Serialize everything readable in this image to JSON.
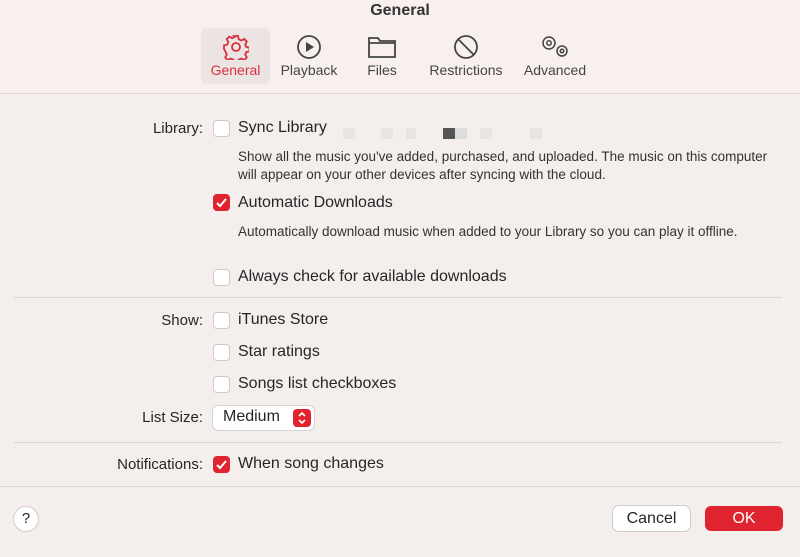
{
  "window": {
    "title": "General"
  },
  "tabs": [
    {
      "label": "General",
      "icon": "gear-icon",
      "active": true
    },
    {
      "label": "Playback",
      "icon": "play-circle-icon"
    },
    {
      "label": "Files",
      "icon": "folder-icon"
    },
    {
      "label": "Restrictions",
      "icon": "prohibited-icon"
    },
    {
      "label": "Advanced",
      "icon": "gears-icon"
    }
  ],
  "library": {
    "label": "Library:",
    "sync": {
      "label": "Sync Library",
      "checked": false,
      "desc": "Show all the music you've added, purchased, and uploaded. The music on this computer will appear on your other devices after syncing with the cloud."
    },
    "auto": {
      "label": "Automatic Downloads",
      "checked": true,
      "desc": "Automatically download music when added to your Library so you can play it offline."
    },
    "always": {
      "label": "Always check for available downloads",
      "checked": false
    }
  },
  "show": {
    "label": "Show:",
    "items": [
      {
        "label": "iTunes Store",
        "checked": false
      },
      {
        "label": "Star ratings",
        "checked": false
      },
      {
        "label": "Songs list checkboxes",
        "checked": false
      }
    ]
  },
  "list_size": {
    "label": "List Size:",
    "value": "Medium"
  },
  "notifications": {
    "label": "Notifications:",
    "item": {
      "label": "When song changes",
      "checked": true
    }
  },
  "footer": {
    "help": "?",
    "cancel": "Cancel",
    "ok": "OK"
  },
  "colors": {
    "accent": "#e0242f"
  }
}
